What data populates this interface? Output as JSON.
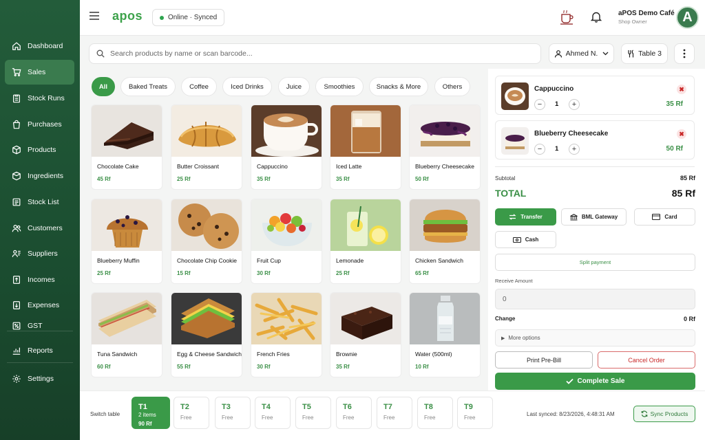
{
  "sidebar": {
    "items": [
      {
        "label": "Dashboard",
        "icon": "home-icon"
      },
      {
        "label": "Sales",
        "icon": "cart-icon"
      },
      {
        "label": "Stock Runs",
        "icon": "clipboard-icon"
      },
      {
        "label": "Purchases",
        "icon": "bag-icon"
      },
      {
        "label": "Products",
        "icon": "box-icon"
      },
      {
        "label": "Ingredients",
        "icon": "cube-icon"
      },
      {
        "label": "Stock List",
        "icon": "list-icon"
      },
      {
        "label": "Customers",
        "icon": "users-icon"
      },
      {
        "label": "Suppliers",
        "icon": "handshake-icon"
      },
      {
        "label": "Incomes",
        "icon": "income-icon"
      },
      {
        "label": "Expenses",
        "icon": "expense-icon"
      },
      {
        "label": "GST",
        "icon": "percent-icon"
      },
      {
        "label": "Reports",
        "icon": "chart-icon"
      },
      {
        "label": "Settings",
        "icon": "gear-icon"
      }
    ],
    "active": "Sales"
  },
  "header": {
    "logo": "apos",
    "status": "Online · Synced",
    "cafe_name": "aPOS Demo Café",
    "cafe_role": "Shop Owner",
    "avatar_letter": "A"
  },
  "search": {
    "placeholder": "Search products by name or scan barcode..."
  },
  "toolbar": {
    "staff": "Ahmed N.",
    "table": "Table 3"
  },
  "categories": [
    "All",
    "Baked Treats",
    "Coffee",
    "Iced Drinks",
    "Juice",
    "Smoothies",
    "Snacks & More",
    "Others"
  ],
  "products": [
    {
      "name": "Chocolate Cake",
      "price": "45 Rf"
    },
    {
      "name": "Butter Croissant",
      "price": "25 Rf"
    },
    {
      "name": "Cappuccino",
      "price": "35 Rf"
    },
    {
      "name": "Iced Latte",
      "price": "35 Rf"
    },
    {
      "name": "Blueberry Cheesecake",
      "price": "50 Rf"
    },
    {
      "name": "Blueberry Muffin",
      "price": "25 Rf"
    },
    {
      "name": "Chocolate Chip Cookie",
      "price": "15 Rf"
    },
    {
      "name": "Fruit Cup",
      "price": "30 Rf"
    },
    {
      "name": "Lemonade",
      "price": "25 Rf"
    },
    {
      "name": "Chicken Sandwich",
      "price": "65 Rf"
    },
    {
      "name": "Tuna Sandwich",
      "price": "60 Rf"
    },
    {
      "name": "Egg & Cheese Sandwich",
      "price": "55 Rf"
    },
    {
      "name": "French Fries",
      "price": "30 Rf"
    },
    {
      "name": "Brownie",
      "price": "35 Rf"
    },
    {
      "name": "Water (500ml)",
      "price": "10 Rf"
    }
  ],
  "cart": {
    "items": [
      {
        "name": "Cappuccino",
        "qty": "1",
        "price": "35 Rf"
      },
      {
        "name": "Blueberry Cheesecake",
        "qty": "1",
        "price": "50 Rf"
      }
    ],
    "subtotal_label": "Subtotal",
    "subtotal": "85 Rf",
    "total_label": "TOTAL",
    "total": "85 Rf",
    "payments": [
      "Transfer",
      "BML Gateway",
      "Card",
      "Cash"
    ],
    "split": "Split payment",
    "receive_label": "Receive Amount",
    "receive_value": "0",
    "change_label": "Change",
    "change_value": "0 Rf",
    "more": "More options",
    "print": "Print Pre-Bill",
    "cancel": "Cancel Order",
    "complete": "Complete Sale"
  },
  "tables": {
    "label": "Switch table",
    "items": [
      {
        "name": "T1",
        "status": "2 items",
        "total": "90 Rf"
      },
      {
        "name": "T2",
        "status": "Free"
      },
      {
        "name": "T3",
        "status": "Free"
      },
      {
        "name": "T4",
        "status": "Free"
      },
      {
        "name": "T5",
        "status": "Free"
      },
      {
        "name": "T6",
        "status": "Free"
      },
      {
        "name": "T7",
        "status": "Free"
      },
      {
        "name": "T8",
        "status": "Free"
      },
      {
        "name": "T9",
        "status": "Free"
      }
    ],
    "last_synced": "Last synced: 8/23/2026, 4:48:31 AM",
    "sync_label": "Sync Products"
  },
  "colors": {
    "accent": "#3a9a48",
    "sidebar": "#1f5535",
    "danger": "#c92828"
  }
}
